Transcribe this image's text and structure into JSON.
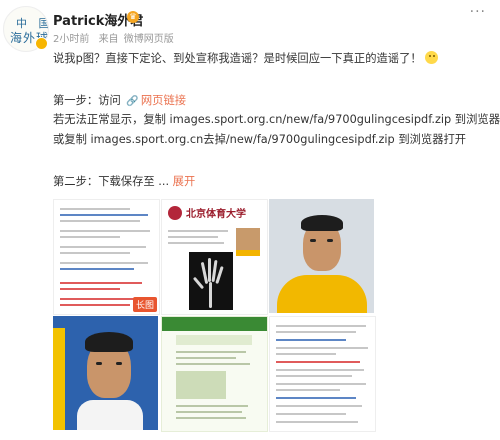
{
  "header": {
    "avatar_text_line1": "中 国",
    "avatar_text_line2": "海外球员",
    "username": "Patrick海外君",
    "time": "2小时前",
    "source_prefix": "来自",
    "source": "微博网页版",
    "more": "···"
  },
  "post": {
    "line1": "说我p图？直接下定论、到处宣称我造谣？是时候回应一下真正的造谣了！",
    "step1_prefix": "第一步：访问",
    "step1_link": "网页链接",
    "line3": "若无法正常显示，复制 images.sport.org.cn/new/fa/9700gulingcesipdf.zip 到浏览器",
    "line4": "或复制 images.sport.org.cn去掉/new/fa/9700gulingcesipdf.zip 到浏览器打开",
    "step2_prefix": "第二步：下载保存至 ...",
    "expand": "展开"
  },
  "images": {
    "badge_long": "长图",
    "bsu_name": "北京体育大学"
  },
  "colors": {
    "accent": "#eb7350",
    "vip": "#f7b500"
  },
  "icons": {
    "link": "link-icon",
    "emoji": "smile-emoji"
  }
}
